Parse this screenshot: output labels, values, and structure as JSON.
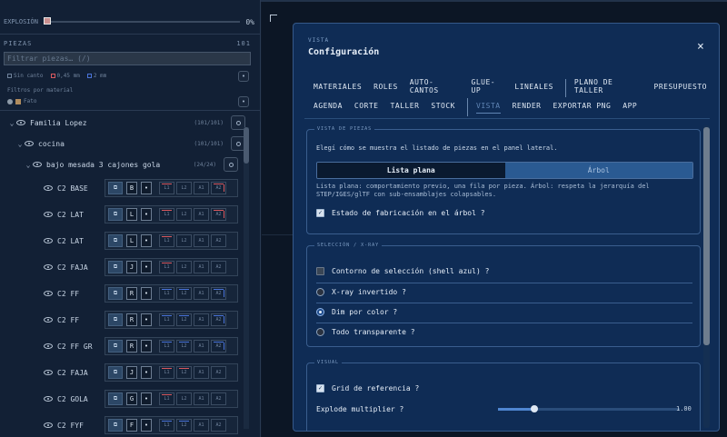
{
  "left": {
    "explode": {
      "label": "EXPLOSIÓN",
      "value": "0%",
      "fraction": 0
    },
    "piezas": {
      "label": "PIEZAS",
      "count": "101"
    },
    "filter": {
      "placeholder": "Filtrar piezas… (/)"
    },
    "legend": {
      "sin_canto": "Sin canto",
      "r045": "0,45 mm",
      "r2": "2 mm"
    },
    "filtros_label": "Filtros por material",
    "material_tag": "Fato",
    "tree": {
      "root": {
        "label": "Familia Lopez",
        "count": "(101/101)"
      },
      "room": {
        "label": "cocina",
        "count": "(101/101)"
      },
      "group": {
        "label": "bajo mesada 3 cajones gola",
        "count": "(24/24)"
      }
    },
    "parts": [
      {
        "name": "C2 BASE",
        "letter": "B",
        "cells": [
          "L1",
          "L2",
          "A1",
          "A2"
        ]
      },
      {
        "name": "C2 LAT",
        "letter": "L",
        "cells": [
          "L1",
          "L2",
          "A1",
          "A2"
        ]
      },
      {
        "name": "C2 LAT",
        "letter": "L",
        "cells": [
          "L1",
          "L2",
          "A1",
          "A2"
        ]
      },
      {
        "name": "C2 FAJA",
        "letter": "J",
        "cells": [
          "L1",
          "L2",
          "A1",
          "A2"
        ]
      },
      {
        "name": "C2 FF",
        "letter": "R",
        "cells": [
          "L1",
          "L2",
          "A1",
          "A2"
        ]
      },
      {
        "name": "C2 FF",
        "letter": "R",
        "cells": [
          "L1",
          "L2",
          "A1",
          "A2"
        ]
      },
      {
        "name": "C2 FF GR",
        "letter": "R",
        "cells": [
          "L1",
          "L2",
          "A1",
          "A2"
        ]
      },
      {
        "name": "C2 FAJA",
        "letter": "J",
        "cells": [
          "L1",
          "L2",
          "A1",
          "A2"
        ]
      },
      {
        "name": "C2 GOLA",
        "letter": "G",
        "cells": [
          "L1",
          "L2",
          "A1",
          "A2"
        ]
      },
      {
        "name": "C2 FYF",
        "letter": "F",
        "cells": [
          "L1",
          "L2",
          "A1",
          "A2"
        ]
      }
    ]
  },
  "modal": {
    "subtitle": "VISTA",
    "title": "Configuración",
    "close": "×",
    "tabs_row1": [
      "MATERIALES",
      "ROLES",
      "AUTO-CANTOS",
      "GLUE-UP",
      "LINEALES",
      "PLANO DE TALLER",
      "PRESUPUESTO"
    ],
    "tabs_row2": [
      "AGENDA",
      "CORTE",
      "TALLER",
      "STOCK",
      "VISTA",
      "RENDER",
      "EXPORTAR PNG",
      "APP"
    ],
    "vista_piezas": {
      "label": "VISTA DE PIEZAS",
      "desc": "Elegí cómo se muestra el listado de piezas en el panel lateral.",
      "opt_plana": "Lista plana",
      "opt_arbol": "Árbol",
      "help1": "Lista plana: comportamiento previo, una fila por pieza. Árbol: respeta la jerarquía del",
      "help2": "STEP/IGES/glTF con sub-ensamblajes colapsables.",
      "estado": "Estado de fabricación en el árbol ?"
    },
    "seleccion": {
      "label": "SELECCIÓN / X-RAY",
      "contorno": "Contorno de selección (shell azul) ?",
      "xray": "X-ray invertido ?",
      "dim": "Dim por color ?",
      "transp": "Todo transparente ?"
    },
    "visual": {
      "label": "VISUAL",
      "grid": "Grid de referencia ?",
      "explode": "Explode multiplier ?",
      "explode_value": "1.00",
      "explode_fraction": 0.2
    }
  }
}
